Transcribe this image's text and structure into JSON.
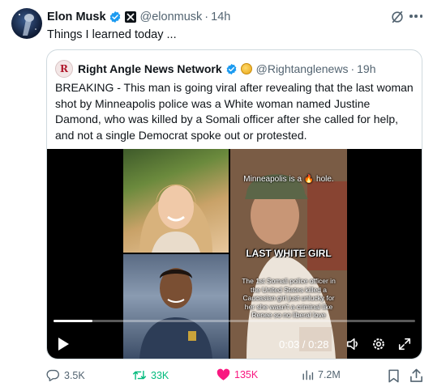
{
  "tweet": {
    "author_name": "Elon Musk",
    "handle": "@elonmusk",
    "separator": "·",
    "time": "14h",
    "text": "Things I learned today ..."
  },
  "quote": {
    "name": "Right Angle News Network",
    "handle": "@Rightanglenews",
    "separator": "·",
    "time": "19h",
    "lines": [
      "BREAKING - This man is going viral after revealing that the last woman",
      "shot by Minneapolis police was a White woman named Justine",
      "Damond, who was killed by a Somali officer after she called for help,",
      "and not a single Democrat spoke out or protested."
    ],
    "video": {
      "overlay_top": "Minneapolis is a 🔥 hole.",
      "overlay_mid": "LAST WHITE GIRL",
      "overlay_bottom": "The 1st Somali police officer in the United States killed a Caucasian girl just unlucky for her she wasn't a criminal like Renee so no liberal love",
      "time": "0:03 / 0:28",
      "progress": 0.107
    }
  },
  "actions": {
    "replies": "3.5K",
    "reposts": "33K",
    "likes": "135K",
    "views": "7.2M"
  },
  "colors": {
    "verified": "#1d9bf0",
    "repost": "#00ba7c",
    "like": "#f91880",
    "muted": "#536471"
  },
  "icons": [
    "grok-icon",
    "more-icon",
    "verified-icon",
    "x-badge-icon",
    "play-icon",
    "volume-icon",
    "settings-icon",
    "fullscreen-icon",
    "reply-icon",
    "repost-icon",
    "like-icon",
    "views-icon",
    "bookmark-icon",
    "share-icon"
  ]
}
